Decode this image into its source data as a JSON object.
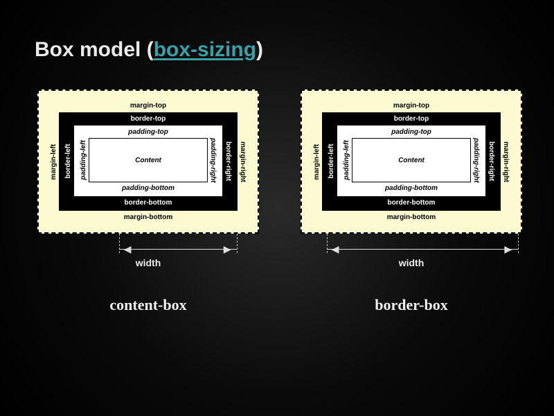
{
  "title_prefix": "Box model (",
  "title_link": "box-sizing",
  "title_suffix": ")",
  "box_labels": {
    "margin_top": "margin-top",
    "margin_bottom": "margin-bottom",
    "margin_left": "margin-left",
    "margin_right": "margin-right",
    "border_top": "border-top",
    "border_bottom": "border-bottom",
    "border_left": "border-left",
    "border_right": "border-right",
    "padding_top": "padding-top",
    "padding_bottom": "padding-bottom",
    "padding_left": "padding-left",
    "padding_right": "padding-right",
    "content": "Content"
  },
  "width_label": "width",
  "left": {
    "caption": "content-box",
    "width_start_pct": 37,
    "width_end_pct": 90
  },
  "right": {
    "caption": "border-box",
    "width_start_pct": 12,
    "width_end_pct": 98
  }
}
